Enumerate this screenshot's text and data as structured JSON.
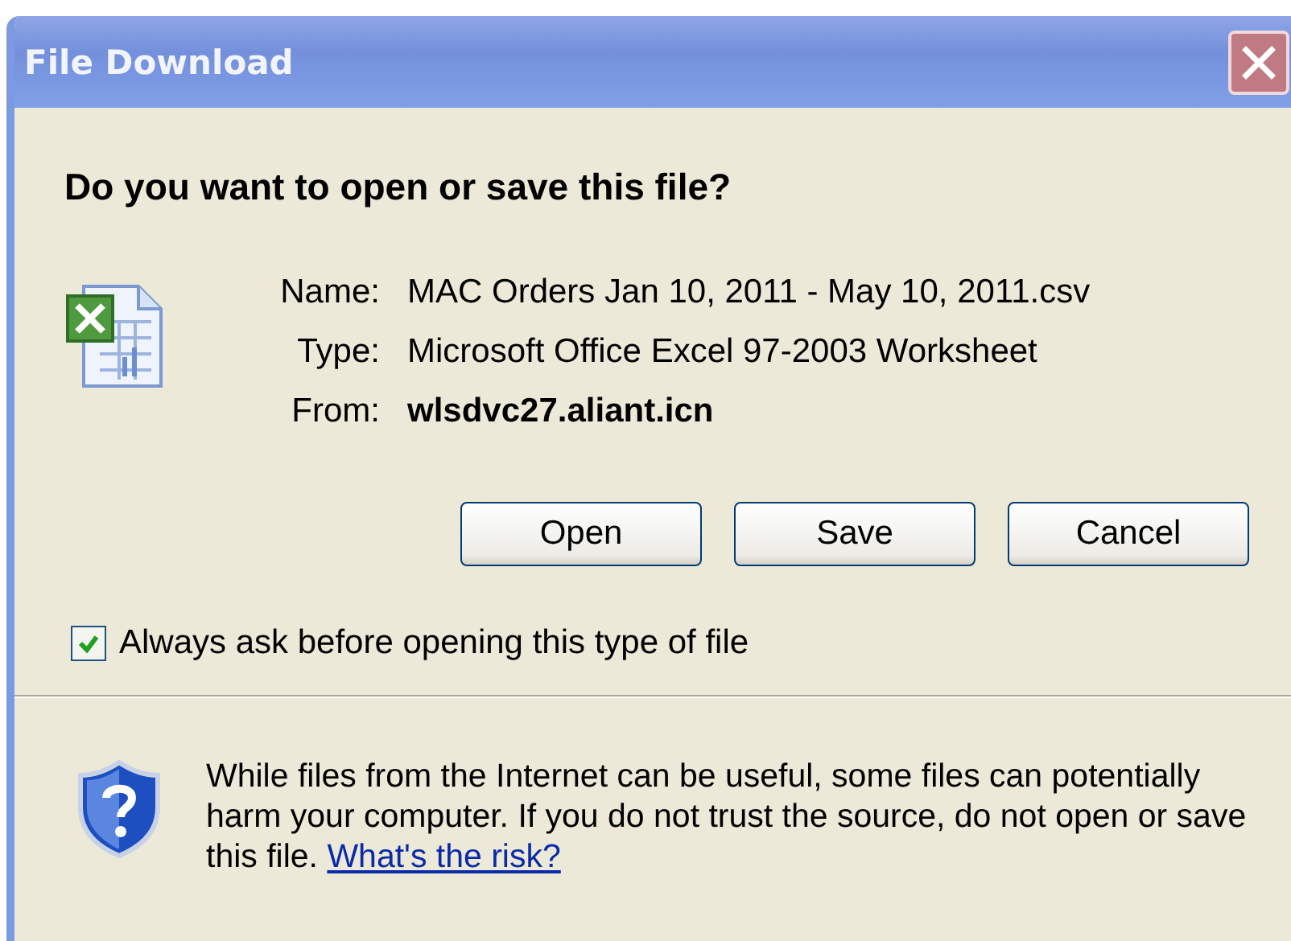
{
  "window": {
    "title": "File Download"
  },
  "heading": "Do you want to open or save this file?",
  "fields": [
    {
      "label": "Name:",
      "value": "MAC Orders Jan 10, 2011 - May 10, 2011.csv",
      "bold": false
    },
    {
      "label": "Type:",
      "value": "Microsoft Office Excel 97-2003 Worksheet",
      "bold": false
    },
    {
      "label": "From:",
      "value": "wlsdvc27.aliant.icn",
      "bold": true
    }
  ],
  "buttons": [
    "Open",
    "Save",
    "Cancel"
  ],
  "checkbox": {
    "label": "Always ask before opening this type of file",
    "checked": true
  },
  "warning": {
    "text": "While files from the Internet can be useful, some files can potentially harm your computer. If you do not trust the source, do not open or save this file.",
    "link": "What's the risk?"
  }
}
